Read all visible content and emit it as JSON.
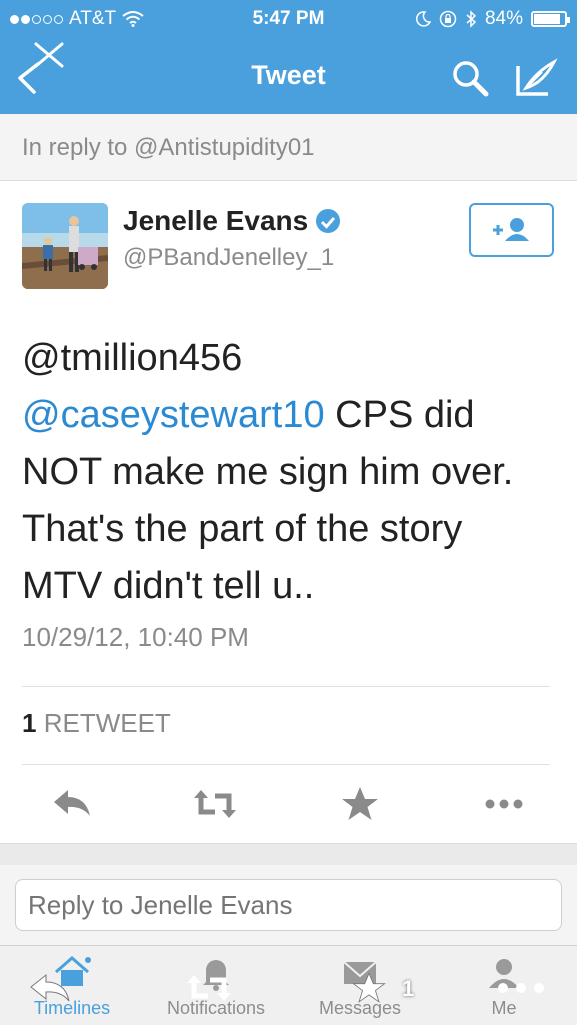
{
  "status_bar": {
    "carrier": "AT&T",
    "time": "5:47 PM",
    "battery": "84%"
  },
  "nav": {
    "title": "Tweet"
  },
  "reply_context": "In reply to @Antistupidity01",
  "author": {
    "name": "Jenelle Evans",
    "handle": "@PBandJenelley_1",
    "verified": true
  },
  "tweet": {
    "mention1": "@tmillion456",
    "mention2": "@caseystewart10",
    "text": "CPS did NOT make me sign him over. That's the part of the story MTV didn't tell u..",
    "timestamp": "10/29/12, 10:40 PM"
  },
  "stats": {
    "retweet_count": "1",
    "retweet_label": "RETWEET"
  },
  "reply_input": {
    "placeholder": "Reply to Jenelle Evans"
  },
  "tabs": [
    {
      "label": "Timelines",
      "active": true
    },
    {
      "label": "Notifications",
      "active": false
    },
    {
      "label": "Messages",
      "active": false
    },
    {
      "label": "Me",
      "active": false
    }
  ],
  "overlay": {
    "favorite_count": "1"
  },
  "colors": {
    "brand": "#4aa0dc",
    "link": "#2b8ad1",
    "muted": "#8a8a8a"
  }
}
